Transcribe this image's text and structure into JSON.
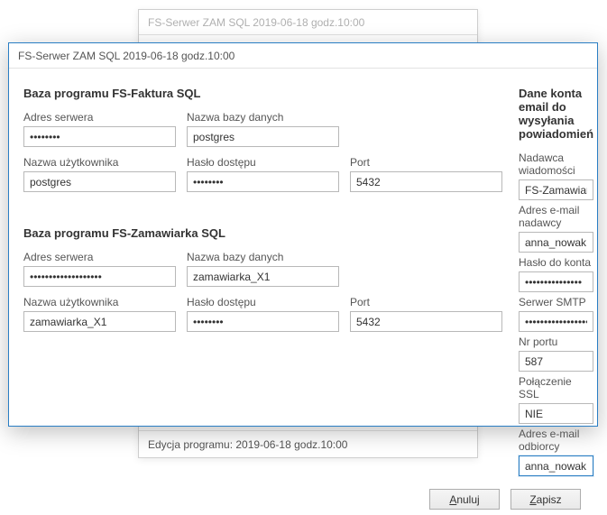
{
  "windowTitle": "FS-Serwer ZAM SQL  2019-06-18 godz.10:00",
  "backFooter": "Edycja programu: 2019-06-18 godz.10:00",
  "left": {
    "faktura": {
      "title": "Baza programu FS-Faktura SQL",
      "serverLabel": "Adres serwera",
      "serverValue": "••••••••",
      "dbLabel": "Nazwa bazy danych",
      "dbValue": "postgres",
      "userLabel": "Nazwa użytkownika",
      "userValue": "postgres",
      "passLabel": "Hasło dostępu",
      "passValue": "••••••••",
      "portLabel": "Port",
      "portValue": "5432"
    },
    "zamawiarka": {
      "title": "Baza programu FS-Zamawiarka SQL",
      "serverLabel": "Adres serwera",
      "serverValue": "•••••••••••••••••••",
      "dbLabel": "Nazwa bazy danych",
      "dbValue": "zamawiarka_X1",
      "userLabel": "Nazwa użytkownika",
      "userValue": "zamawiarka_X1",
      "passLabel": "Hasło dostępu",
      "passValue": "••••••••",
      "portLabel": "Port",
      "portValue": "5432"
    }
  },
  "right": {
    "title": "Dane konta email do wysyłania powiadomień",
    "senderNameLabel": "Nadawca wiadomości",
    "senderNameValue": "FS-Zamawiarka SQL",
    "senderEmailLabel": "Adres e-mail nadawcy",
    "senderEmailValue": "anna_nowak@pocztax.pl",
    "passLabel": "Hasło do konta",
    "passValue": "•••••••••••••••",
    "smtpLabel": "Serwer SMTP",
    "smtpValue": "••••••••••••••••••••••••",
    "portLabel": "Nr portu",
    "portValue": "587",
    "sslLabel": "Połączenie SSL",
    "sslValue": "NIE",
    "recipientLabel": "Adres e-mail odbiorcy",
    "recipientValue": "anna_nowak@pocztax.pl"
  },
  "buttons": {
    "cancel": "Anuluj",
    "save": "Zapisz"
  }
}
